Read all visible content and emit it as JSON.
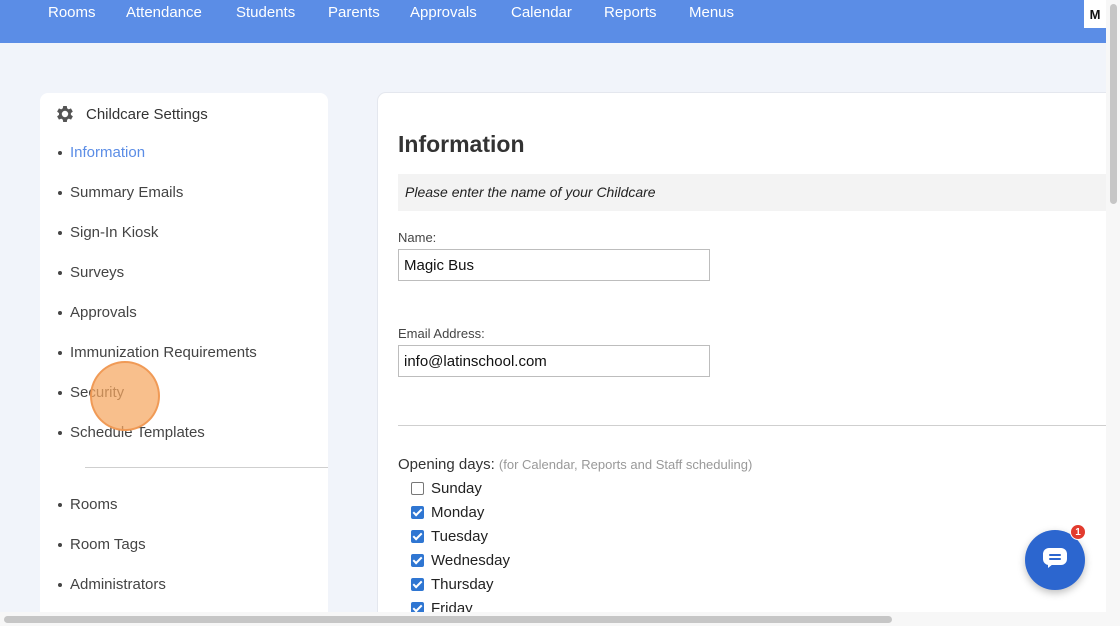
{
  "nav": {
    "items": [
      {
        "id": "rooms",
        "label": "Rooms"
      },
      {
        "id": "attendance",
        "label": "Attendance"
      },
      {
        "id": "students",
        "label": "Students"
      },
      {
        "id": "parents",
        "label": "Parents"
      },
      {
        "id": "approvals",
        "label": "Approvals"
      },
      {
        "id": "calendar",
        "label": "Calendar"
      },
      {
        "id": "reports",
        "label": "Reports"
      },
      {
        "id": "menus",
        "label": "Menus"
      }
    ],
    "user_initial": "M"
  },
  "sidebar": {
    "title": "Childcare Settings",
    "title_icon": "gear-icon",
    "items": [
      {
        "label": "Information",
        "active": true
      },
      {
        "label": "Summary Emails"
      },
      {
        "label": "Sign-In Kiosk"
      },
      {
        "label": "Surveys"
      },
      {
        "label": "Approvals"
      },
      {
        "label": "Immunization Requirements"
      },
      {
        "label": "Security"
      },
      {
        "label": "Schedule Templates"
      },
      {
        "label": "Rooms"
      },
      {
        "label": "Room Tags"
      },
      {
        "label": "Administrators"
      }
    ]
  },
  "main": {
    "title": "Information",
    "hint": "Please enter the name of your Childcare",
    "name_label": "Name:",
    "name_value": "Magic Bus",
    "email_label": "Email Address:",
    "email_value": "info@latinschool.com",
    "opening_days_label": "Opening days:",
    "opening_days_note": "(for Calendar, Reports and Staff scheduling)",
    "days": [
      {
        "label": "Sunday",
        "checked": false
      },
      {
        "label": "Monday",
        "checked": true
      },
      {
        "label": "Tuesday",
        "checked": true
      },
      {
        "label": "Wednesday",
        "checked": true
      },
      {
        "label": "Thursday",
        "checked": true
      },
      {
        "label": "Friday",
        "checked": true
      }
    ]
  },
  "chat": {
    "badge_count": "1",
    "icon": "chat-icon"
  },
  "colors": {
    "nav_bg": "#5b8de6",
    "accent": "#5b8de6",
    "checkbox": "#2f76d2",
    "chat_bg": "#2c66cf",
    "badge": "#e23b2e",
    "highlight": "#f5a660"
  }
}
